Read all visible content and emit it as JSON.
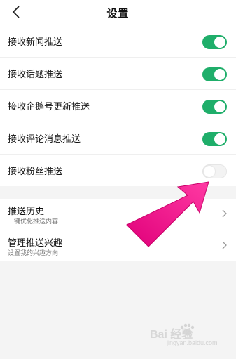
{
  "header": {
    "title": "设置",
    "back_icon": "back-chevron-icon"
  },
  "toggles": [
    {
      "label": "接收新闻推送",
      "on": true
    },
    {
      "label": "接收话题推送",
      "on": true
    },
    {
      "label": "接收企鹅号更新推送",
      "on": true
    },
    {
      "label": "接收评论消息推送",
      "on": true
    },
    {
      "label": "接收粉丝推送",
      "on": false
    }
  ],
  "nav": [
    {
      "title": "推送历史",
      "subtitle": "一键优化推送内容"
    },
    {
      "title": "管理推送兴趣",
      "subtitle": "设置我的兴趣方向"
    }
  ],
  "watermark": {
    "main": "Bai 经验",
    "sub": "jingyan.baidu.com"
  },
  "colors": {
    "toggle_on": "#1fae6a",
    "annotation_arrow": "#ff1f8e"
  }
}
